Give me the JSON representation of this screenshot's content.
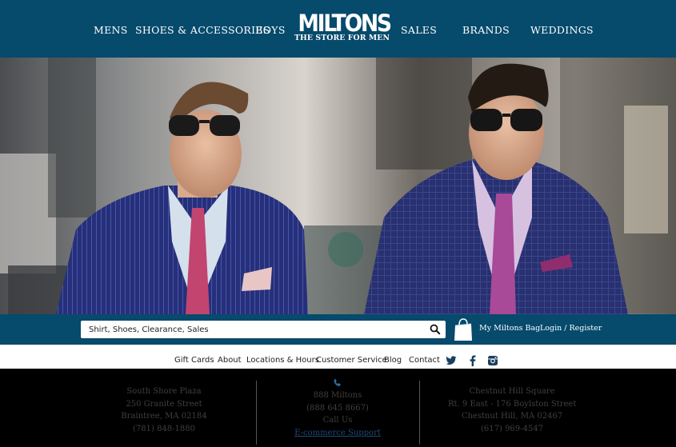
{
  "nav": {
    "left": [
      "MENS",
      "SHOES & ACCESSORIES",
      "BOYS"
    ],
    "right": [
      "SALES",
      "BRANDS",
      "WEDDINGS"
    ]
  },
  "logo": {
    "main": "MILTONS",
    "sub": "THE STORE FOR MEN"
  },
  "search": {
    "placeholder": "Shirt, Shoes, Clearance, Sales"
  },
  "account": {
    "bag": "My Miltons Bag",
    "login": "Login / Register"
  },
  "footer_links": [
    "Gift Cards",
    "About",
    "Locations & Hours",
    "Customer Service",
    "Blog",
    "Contact"
  ],
  "social": [
    "twitter-icon",
    "facebook-icon",
    "instagram-icon"
  ],
  "stores": {
    "left": [
      "South Shore Plaza",
      "250 Granite Street",
      "Braintree, MA 02184",
      "(781) 848-1880"
    ],
    "center": [
      "888 Miltons",
      "(888 645 8667)",
      "Call Us"
    ],
    "center_link": "E-commerce Support",
    "right": [
      "Chestnut Hill Square",
      "Rt. 9 East - 176 Boylston Street",
      "Chestnut Hill, MA 02467",
      "(617) 969-4547"
    ]
  },
  "colors": {
    "brand_blue": "#064a6c",
    "footer_bg": "#000000",
    "footer_text": "#3f3f3f"
  }
}
